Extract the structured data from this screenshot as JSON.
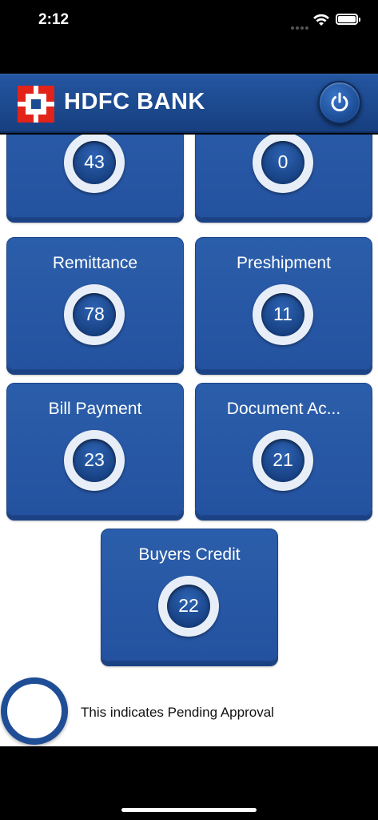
{
  "status": {
    "time": "2:12"
  },
  "header": {
    "brand": "HDFC BANK"
  },
  "tiles": [
    {
      "label": "",
      "count": "43"
    },
    {
      "label": "",
      "count": "0"
    },
    {
      "label": "Remittance",
      "count": "78"
    },
    {
      "label": "Preshipment",
      "count": "11"
    },
    {
      "label": "Bill Payment",
      "count": "23"
    },
    {
      "label": "Document Ac...",
      "count": "21"
    },
    {
      "label": "Buyers Credit",
      "count": "22"
    }
  ],
  "legend": {
    "text": "This indicates Pending Approval"
  },
  "colors": {
    "brand_blue": "#2456a0",
    "brand_red": "#e2231a",
    "tile_blue": "#2b5eaa"
  },
  "icons": {
    "power": "power-icon",
    "wifi": "wifi-icon",
    "battery": "battery-icon"
  }
}
